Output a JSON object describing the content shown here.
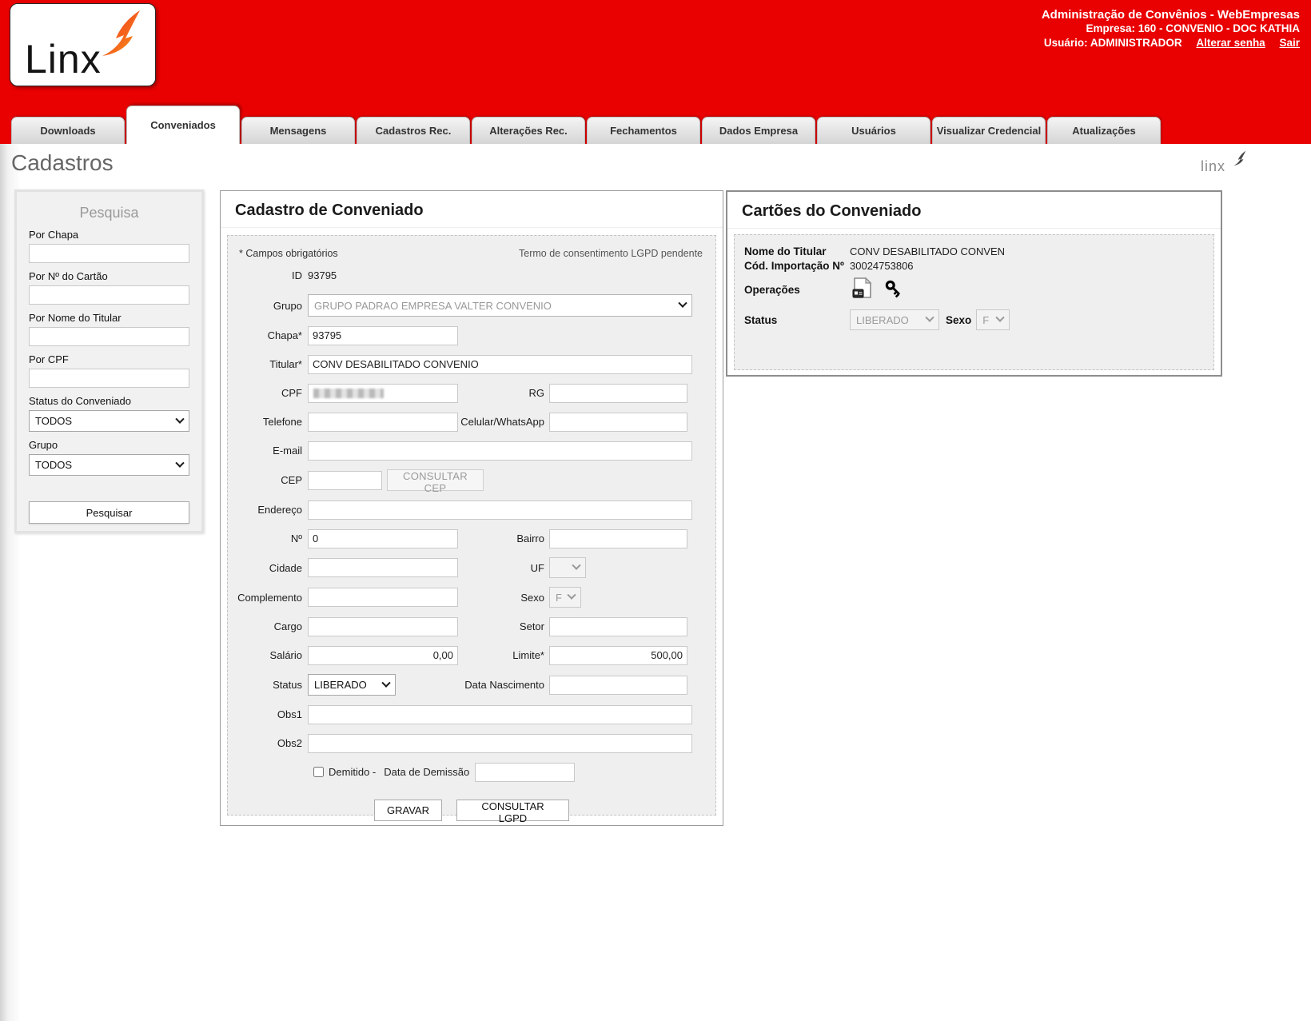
{
  "header": {
    "logo_text": "Linx",
    "app_title": "Administração de Convênios - WebEmpresas",
    "company_line": "Empresa: 160 - CONVENIO - DOC KATHIA",
    "user_label": "Usuário: ADMINISTRADOR",
    "change_password_link": "Alterar senha",
    "logout_link": "Sair",
    "brand_red": "#e90000"
  },
  "tabs": [
    {
      "label": "Downloads",
      "active": false
    },
    {
      "label": "Conveniados",
      "active": true
    },
    {
      "label": "Mensagens",
      "active": false
    },
    {
      "label": "Cadastros Rec.",
      "active": false
    },
    {
      "label": "Alterações Rec.",
      "active": false
    },
    {
      "label": "Fechamentos",
      "active": false
    },
    {
      "label": "Dados Empresa",
      "active": false
    },
    {
      "label": "Usuários",
      "active": false
    },
    {
      "label": "Visualizar Credencial",
      "active": false
    },
    {
      "label": "Atualizações",
      "active": false
    }
  ],
  "page": {
    "title": "Cadastros",
    "watermark": "linx"
  },
  "search_panel": {
    "title": "Pesquisa",
    "chapa_label": "Por Chapa",
    "chapa_value": "",
    "cartao_label": "Por Nº do Cartão",
    "cartao_value": "",
    "titular_label": "Por Nome do Titular",
    "titular_value": "",
    "cpf_label": "Por CPF",
    "cpf_value": "",
    "status_label": "Status do Conveniado",
    "status_value": "TODOS",
    "grupo_label": "Grupo",
    "grupo_value": "TODOS",
    "search_button": "Pesquisar"
  },
  "member_form": {
    "title": "Cadastro de Conveniado",
    "required_note": "* Campos obrigatórios",
    "lgpd_note": "Termo de consentimento LGPD pendente",
    "id": {
      "label": "ID",
      "value": "93795"
    },
    "grupo": {
      "label": "Grupo",
      "value": "GRUPO PADRAO EMPRESA VALTER CONVENIO"
    },
    "chapa": {
      "label": "Chapa*",
      "value": "93795"
    },
    "titular": {
      "label": "Titular*",
      "value": "CONV DESABILITADO CONVENIO"
    },
    "cpf": {
      "label": "CPF",
      "value": "",
      "redacted": true
    },
    "rg": {
      "label": "RG",
      "value": ""
    },
    "telefone": {
      "label": "Telefone",
      "value": ""
    },
    "celular": {
      "label": "Celular/WhatsApp",
      "value": ""
    },
    "email": {
      "label": "E-mail",
      "value": ""
    },
    "cep": {
      "label": "CEP",
      "value": ""
    },
    "consultar_cep_button": "CONSULTAR CEP",
    "endereco": {
      "label": "Endereço",
      "value": ""
    },
    "numero": {
      "label": "Nº",
      "value": "0"
    },
    "bairro": {
      "label": "Bairro",
      "value": ""
    },
    "cidade": {
      "label": "Cidade",
      "value": ""
    },
    "uf": {
      "label": "UF",
      "value": ""
    },
    "complemento": {
      "label": "Complemento",
      "value": ""
    },
    "sexo": {
      "label": "Sexo",
      "value": "F"
    },
    "cargo": {
      "label": "Cargo",
      "value": ""
    },
    "setor": {
      "label": "Setor",
      "value": ""
    },
    "salario": {
      "label": "Salário",
      "value": "0,00"
    },
    "limite": {
      "label": "Limite*",
      "value": "500,00"
    },
    "status": {
      "label": "Status",
      "value": "LIBERADO"
    },
    "data_nascimento": {
      "label": "Data Nascimento",
      "value": ""
    },
    "obs1": {
      "label": "Obs1",
      "value": ""
    },
    "obs2": {
      "label": "Obs2",
      "value": ""
    },
    "demitido_label": "Demitido -",
    "demissao_label": "Data de Demissão",
    "demissao_value": "",
    "gravar_button": "GRAVAR",
    "consultar_lgpd_button": "CONSULTAR LGPD"
  },
  "cards_panel": {
    "title": "Cartões do Conveniado",
    "holder_label": "Nome do Titular",
    "holder_value": "CONV DESABILITADO CONVEN",
    "import_label": "Cód. Importação Nº",
    "import_value": "30024753806",
    "operations_label": "Operações",
    "status_label": "Status",
    "status_value": "LIBERADO",
    "sexo_label": "Sexo",
    "sexo_value": "F"
  }
}
